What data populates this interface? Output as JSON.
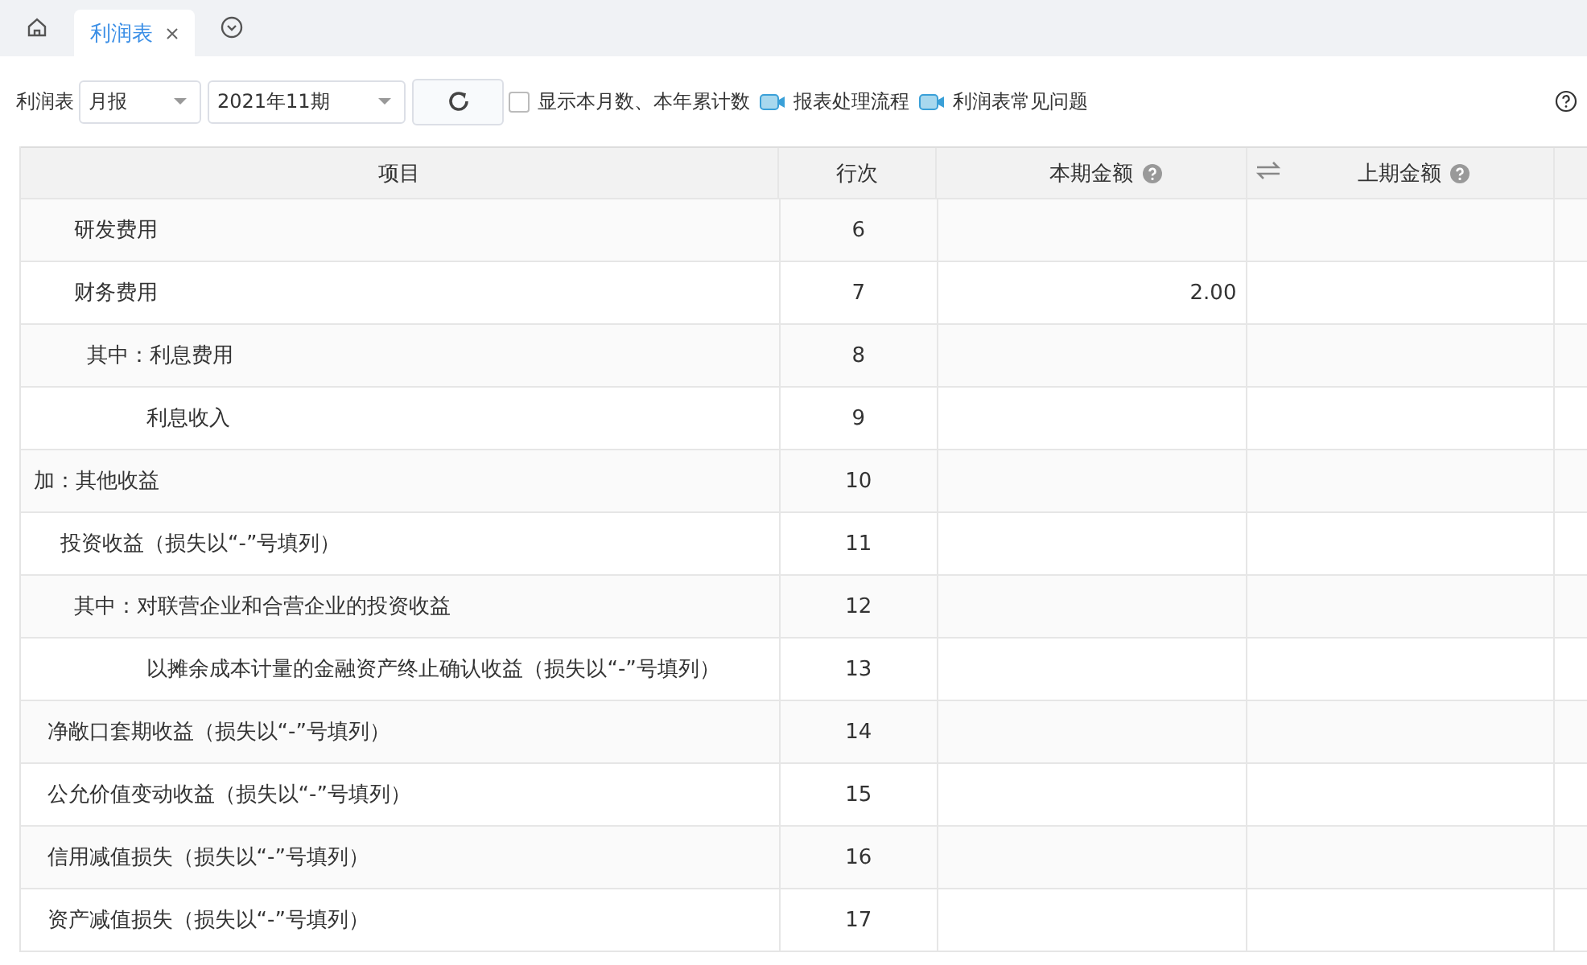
{
  "tabs": [
    {
      "label": "利润表",
      "selected": true
    }
  ],
  "toolbar": {
    "label": "利润表",
    "period_type": "月报",
    "period": "2021年11期",
    "show_cumulative": {
      "label": "显示本月数、本年累计数",
      "checked": false
    },
    "links": [
      "报表处理流程",
      "利润表常见问题"
    ]
  },
  "table": {
    "columns": [
      "项目",
      "行次",
      "本期金额",
      "上期金额"
    ],
    "rows": [
      {
        "item": "      研发费用",
        "line": "6",
        "current": "",
        "previous": ""
      },
      {
        "item": "      财务费用",
        "line": "7",
        "current": "2.00",
        "previous": ""
      },
      {
        "item": "        其中：利息费用",
        "line": "8",
        "current": "",
        "previous": ""
      },
      {
        "item": "                 利息收入",
        "line": "9",
        "current": "",
        "previous": ""
      },
      {
        "item": "加：其他收益",
        "line": "10",
        "current": "",
        "previous": ""
      },
      {
        "item": "    投资收益（损失以“-”号填列）",
        "line": "11",
        "current": "",
        "previous": ""
      },
      {
        "item": "      其中：对联营企业和合营企业的投资收益",
        "line": "12",
        "current": "",
        "previous": ""
      },
      {
        "item": "                 以摊余成本计量的金融资产终止确认收益（损失以“-”号填列）",
        "line": "13",
        "current": "",
        "previous": ""
      },
      {
        "item": "  净敞口套期收益（损失以“-”号填列）",
        "line": "14",
        "current": "",
        "previous": ""
      },
      {
        "item": "  公允价值变动收益（损失以“-”号填列）",
        "line": "15",
        "current": "",
        "previous": ""
      },
      {
        "item": "  信用减值损失（损失以“-”号填列）",
        "line": "16",
        "current": "",
        "previous": ""
      },
      {
        "item": "  资产减值损失（损失以“-”号填列）",
        "line": "17",
        "current": "",
        "previous": ""
      }
    ]
  }
}
